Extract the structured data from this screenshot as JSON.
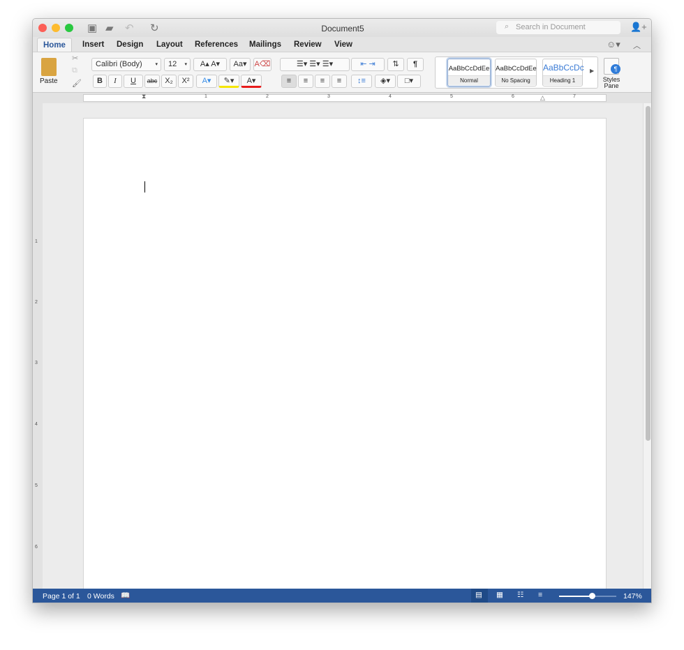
{
  "window": {
    "title": "Document5",
    "search_placeholder": "Search in Document"
  },
  "tabs": [
    "Home",
    "Insert",
    "Design",
    "Layout",
    "References",
    "Mailings",
    "Review",
    "View"
  ],
  "ribbon": {
    "paste_label": "Paste",
    "font_name": "Calibri (Body)",
    "font_size": "12",
    "styles": [
      {
        "preview": "AaBbCcDdEe",
        "label": "Normal"
      },
      {
        "preview": "AaBbCcDdEe",
        "label": "No Spacing"
      },
      {
        "preview": "AaBbCcDc",
        "label": "Heading 1"
      }
    ],
    "styles_pane_label": "Styles Pane",
    "bold": "B",
    "italic": "I",
    "underline": "U",
    "strike": "abc",
    "subscript": "X₂",
    "superscript": "X²"
  },
  "ruler": {
    "h": [
      "1",
      "2",
      "3",
      "4",
      "5",
      "6",
      "7"
    ],
    "v": [
      "1",
      "2",
      "3",
      "4",
      "5",
      "6"
    ]
  },
  "status": {
    "page": "Page 1 of 1",
    "words": "0 Words",
    "zoom": "147%",
    "zoom_fraction": 0.6
  },
  "colors": {
    "accent": "#2b579a",
    "highlight": "#f5e600",
    "font_color": "#e81c1c"
  }
}
